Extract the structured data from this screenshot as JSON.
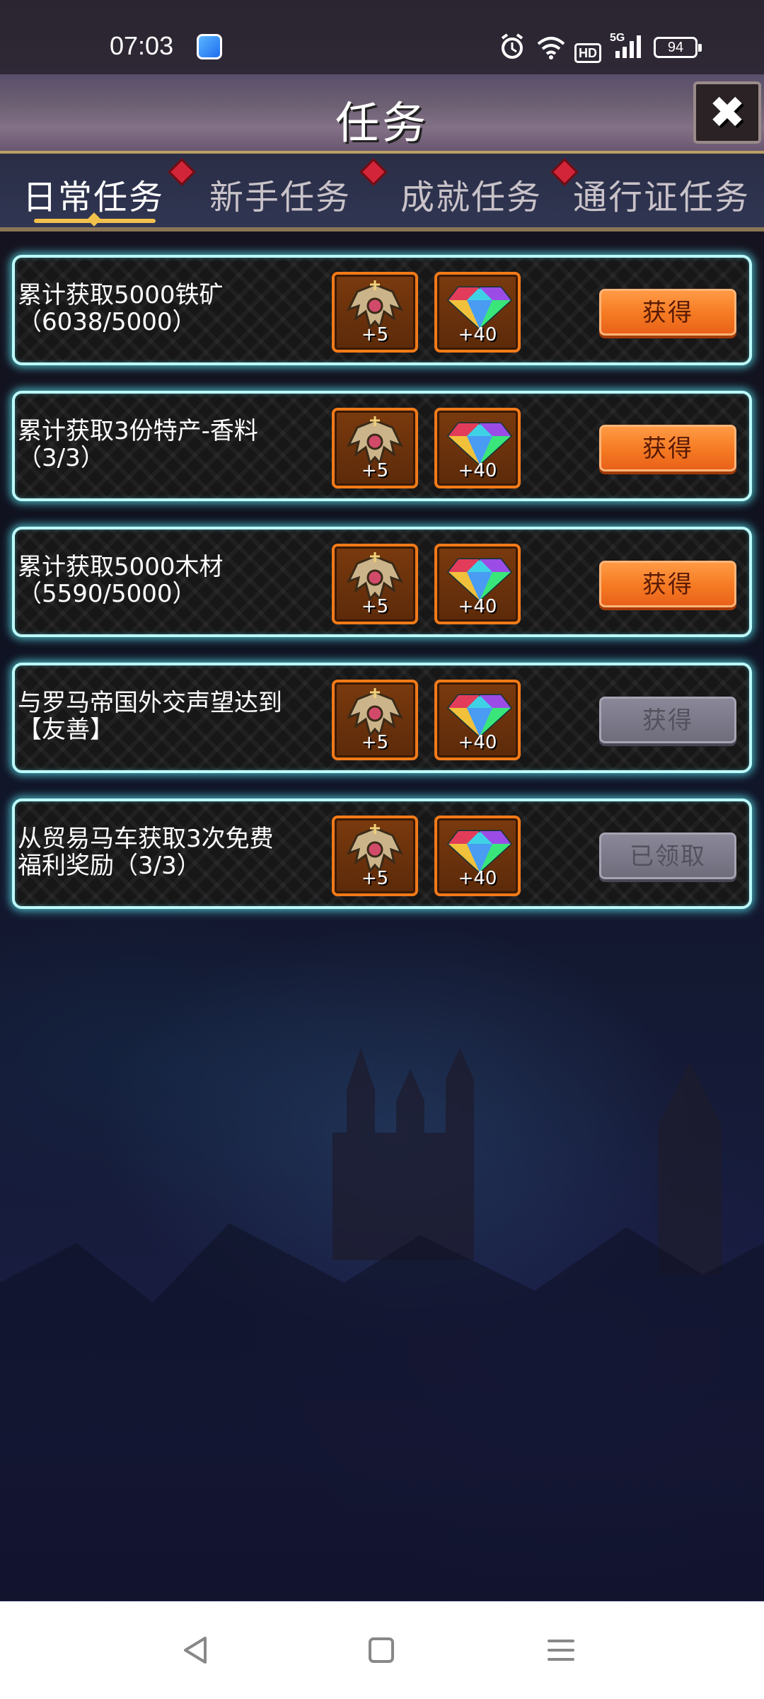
{
  "status_bar": {
    "time": "07:03",
    "hd_label": "HD",
    "network_label": "5G",
    "battery": "94"
  },
  "header": {
    "title": "任务"
  },
  "tabs": [
    {
      "label": "日常任务",
      "active": true,
      "badge": true
    },
    {
      "label": "新手任务",
      "active": false,
      "badge": true
    },
    {
      "label": "成就任务",
      "active": false,
      "badge": true
    },
    {
      "label": "通行证任务",
      "active": false,
      "badge": false
    }
  ],
  "quests": [
    {
      "line1": "累计获取5000铁矿",
      "line2": "（6038/5000）",
      "reward1_icon": "winged-emblem-icon",
      "reward1_amount": "+5",
      "reward2_icon": "rainbow-gem-icon",
      "reward2_amount": "+40",
      "button_label": "获得",
      "button_state": "active"
    },
    {
      "line1": "累计获取3份特产-香料",
      "line2": "（3/3）",
      "reward1_icon": "winged-emblem-icon",
      "reward1_amount": "+5",
      "reward2_icon": "rainbow-gem-icon",
      "reward2_amount": "+40",
      "button_label": "获得",
      "button_state": "active"
    },
    {
      "line1": "累计获取5000木材",
      "line2": "（5590/5000）",
      "reward1_icon": "winged-emblem-icon",
      "reward1_amount": "+5",
      "reward2_icon": "rainbow-gem-icon",
      "reward2_amount": "+40",
      "button_label": "获得",
      "button_state": "active"
    },
    {
      "line1": "与罗马帝国外交声望达到",
      "line2": "【友善】",
      "reward1_icon": "winged-emblem-icon",
      "reward1_amount": "+5",
      "reward2_icon": "rainbow-gem-icon",
      "reward2_amount": "+40",
      "button_label": "获得",
      "button_state": "disabled"
    },
    {
      "line1": "从贸易马车获取3次免费",
      "line2": "福利奖励（3/3）",
      "reward1_icon": "winged-emblem-icon",
      "reward1_amount": "+5",
      "reward2_icon": "rainbow-gem-icon",
      "reward2_amount": "+40",
      "button_label": "已领取",
      "button_state": "disabled"
    }
  ],
  "colors": {
    "card_glow": "#5ae6f0",
    "button_active": "#f57a22",
    "button_disabled": "#6f6c7c",
    "reward_border": "#f27a18",
    "badge_red": "#d3253a"
  }
}
